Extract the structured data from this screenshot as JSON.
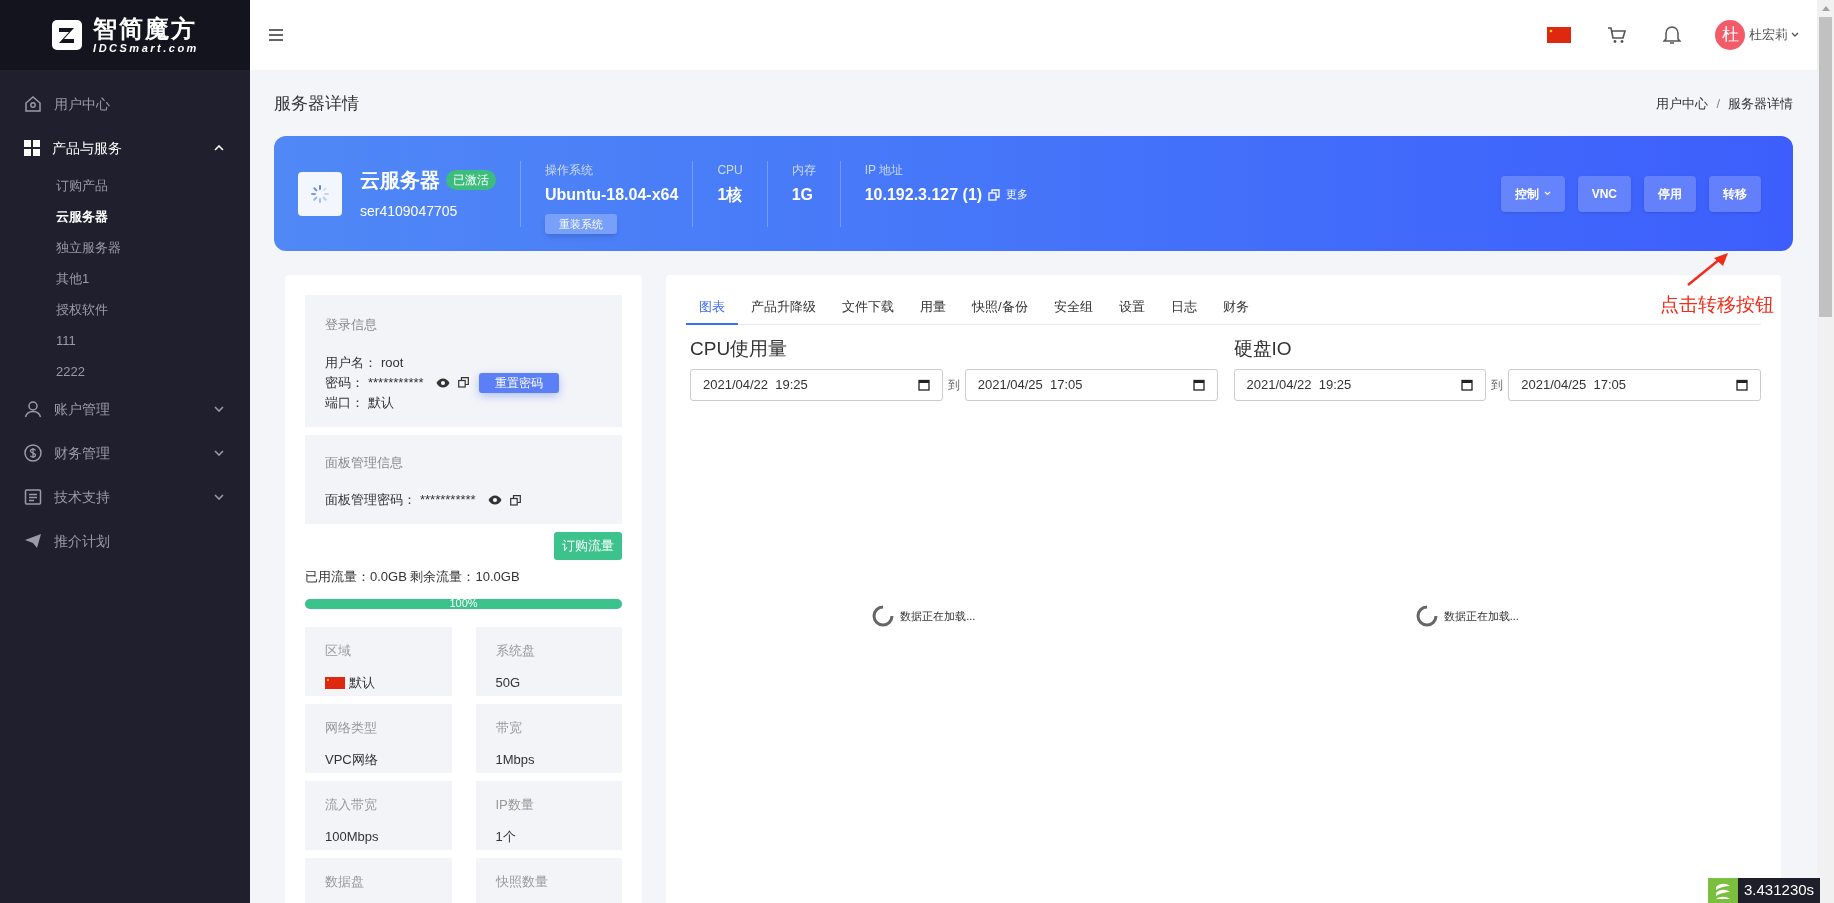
{
  "logo": {
    "name": "智简魔方",
    "domain": "IDCSmart.com"
  },
  "sidebar": {
    "items": [
      {
        "label": "用户中心",
        "selected": false
      },
      {
        "label": "产品与服务",
        "selected": true,
        "expanded": true,
        "children": [
          {
            "label": "订购产品",
            "selected": false
          },
          {
            "label": "云服务器",
            "selected": true
          },
          {
            "label": "独立服务器",
            "selected": false
          },
          {
            "label": "其他1",
            "selected": false
          },
          {
            "label": "授权软件",
            "selected": false
          },
          {
            "label": "111",
            "selected": false
          },
          {
            "label": "2222",
            "selected": false
          }
        ]
      },
      {
        "label": "账户管理",
        "selected": false,
        "expanded": false
      },
      {
        "label": "财务管理",
        "selected": false,
        "expanded": false
      },
      {
        "label": "技术支持",
        "selected": false,
        "expanded": false
      },
      {
        "label": "推介计划",
        "selected": false
      }
    ]
  },
  "header": {
    "avatar": "杜",
    "username": "杜宏莉"
  },
  "page_title": "服务器详情",
  "breadcrumb": {
    "items": [
      "用户中心",
      "服务器详情"
    ],
    "separator": "/"
  },
  "banner": {
    "title": "云服务器",
    "status": "已激活",
    "id": "ser4109047705",
    "info": [
      {
        "label": "操作系统",
        "value": "Ubuntu-18.04-x64",
        "button": "重装系统"
      },
      {
        "label": "CPU",
        "value": "1核"
      },
      {
        "label": "内存",
        "value": "1G"
      },
      {
        "label": "IP 地址",
        "value": "10.192.3.127 (1)",
        "more": "更多"
      }
    ],
    "buttons": [
      {
        "label": "控制",
        "dropdown": true
      },
      {
        "label": "VNC",
        "dropdown": false
      },
      {
        "label": "停用",
        "dropdown": false
      },
      {
        "label": "转移",
        "dropdown": false
      }
    ]
  },
  "annotation": {
    "text": "点击转移按钮"
  },
  "login_info": {
    "title": "登录信息",
    "rows": [
      {
        "label": "用户名：",
        "value": "root",
        "kind": "plain"
      },
      {
        "label": "密码：",
        "value": "***********",
        "kind": "secret",
        "button": "重置密码"
      },
      {
        "label": "端口：",
        "value": "默认",
        "kind": "plain"
      }
    ]
  },
  "panel_info": {
    "title": "面板管理信息",
    "rows": [
      {
        "label": "面板管理密码：",
        "value": "***********",
        "kind": "secret"
      }
    ]
  },
  "traffic": {
    "buy_button": "订购流量",
    "usage": "已用流量：0.0GB 剩余流量：10.0GB",
    "level": 1,
    "label": "100%"
  },
  "specs": [
    {
      "label": "区域",
      "value": "默认",
      "kind": "region"
    },
    {
      "label": "系统盘",
      "value": "50G",
      "kind": "plain"
    },
    {
      "label": "网络类型",
      "value": "VPC网络",
      "kind": "plain"
    },
    {
      "label": "带宽",
      "value": "1Mbps",
      "kind": "plain"
    },
    {
      "label": "流入带宽",
      "value": "100Mbps",
      "kind": "plain"
    },
    {
      "label": "IP数量",
      "value": "1个",
      "kind": "plain"
    },
    {
      "label": "数据盘"
    },
    {
      "label": "快照数量"
    }
  ],
  "tabs": [
    {
      "label": "图表",
      "selected": true
    },
    {
      "label": "产品升降级",
      "selected": false
    },
    {
      "label": "文件下载",
      "selected": false
    },
    {
      "label": "用量",
      "selected": false
    },
    {
      "label": "快照/备份",
      "selected": false
    },
    {
      "label": "安全组",
      "selected": false
    },
    {
      "label": "设置",
      "selected": false
    },
    {
      "label": "日志",
      "selected": false
    },
    {
      "label": "财务",
      "selected": false
    }
  ],
  "charts": [
    {
      "title": "CPU使用量",
      "from": "2021/04/22  19:25",
      "separator": "到",
      "to": "2021/04/25  17:05",
      "loading": "数据正在加载..."
    },
    {
      "title": "硬盘IO",
      "from": "2021/04/22  19:25",
      "separator": "到",
      "to": "2021/04/25  17:05",
      "loading": "数据正在加载..."
    }
  ],
  "timer": "3.431230s"
}
